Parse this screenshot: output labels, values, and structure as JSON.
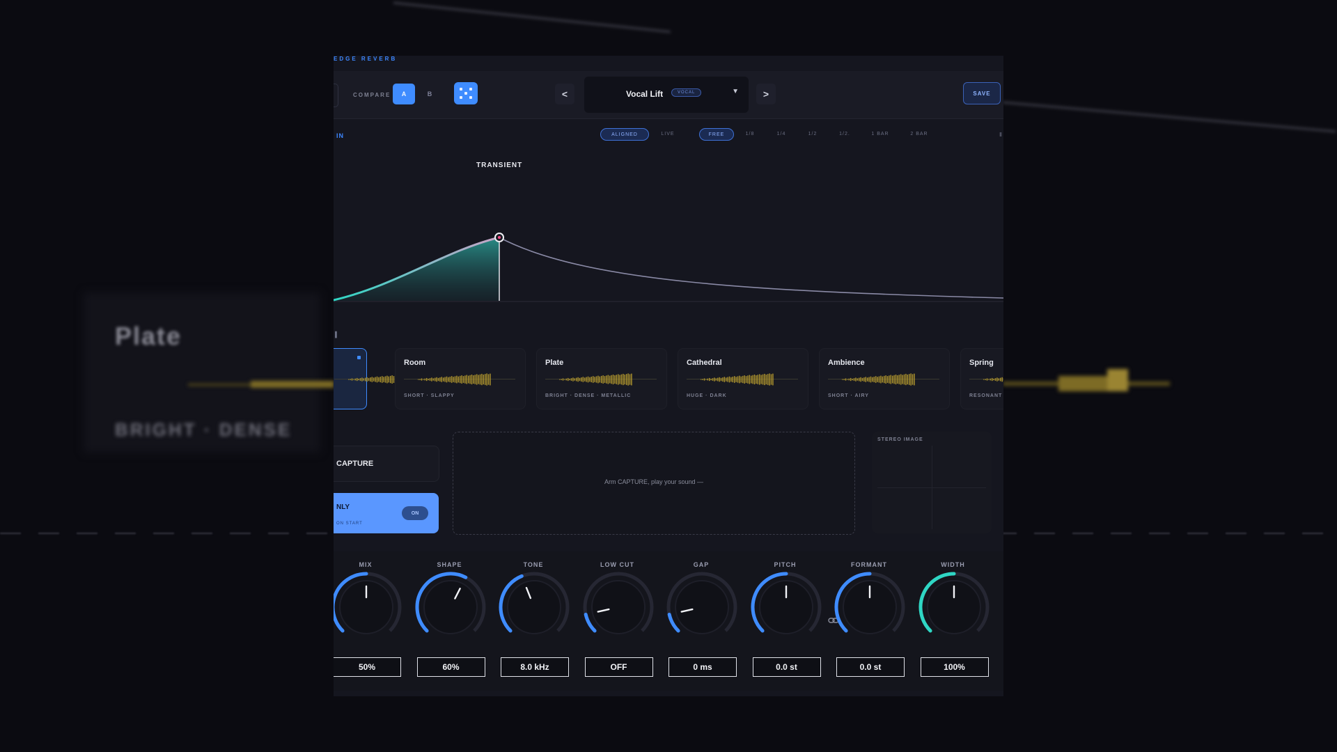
{
  "background": {
    "blurred_title": "Plate",
    "blurred_subtitle": "BRIGHT · DENSE"
  },
  "plugin": {
    "brand_strip": "EDGE REVERB",
    "compare": {
      "label": "COMPARE",
      "a": "A",
      "b": "B"
    },
    "preset": {
      "prev": "<",
      "next": ">",
      "name": "Vocal Lift",
      "tag": "VOCAL",
      "dropdown": "▼"
    },
    "save_label": "SAVE",
    "input_label": "IN",
    "sync_modes": [
      "ALIGNED",
      "LIVE"
    ],
    "time_divisions": [
      "FREE",
      "1/8",
      "1/4",
      "1/2",
      "1/2.",
      "1 BAR",
      "2 BAR"
    ],
    "selected_sync_mode": "ALIGNED",
    "selected_division": "FREE",
    "envelope": {
      "transient_label": "TRANSIENT"
    },
    "reverb_types": [
      {
        "name": "",
        "desc": "",
        "selected": true
      },
      {
        "name": "Room",
        "desc": "SHORT · SLAPPY"
      },
      {
        "name": "Plate",
        "desc": "BRIGHT · DENSE · METALLIC"
      },
      {
        "name": "Cathedral",
        "desc": "HUGE · DARK"
      },
      {
        "name": "Ambience",
        "desc": "SHORT · AIRY"
      },
      {
        "name": "Spring",
        "desc": "RESONANT ·"
      }
    ],
    "capture": {
      "label": "CAPTURE"
    },
    "only": {
      "label": "NLY",
      "sub": "ON START",
      "toggle": "ON"
    },
    "dropzone_text": "Arm CAPTURE, play your sound —",
    "stereo_label": "STEREO IMAGE",
    "knobs": [
      {
        "label": "MIX",
        "value": "50%",
        "level": 0.5,
        "accent": "#3f8cff"
      },
      {
        "label": "SHAPE",
        "value": "60%",
        "level": 0.6,
        "accent": "#3f8cff"
      },
      {
        "label": "TONE",
        "value": "8.0 kHz",
        "level": 0.42,
        "accent": "#3f8cff"
      },
      {
        "label": "LOW CUT",
        "value": "OFF",
        "level": 0.12,
        "accent": "#3f8cff"
      },
      {
        "label": "GAP",
        "value": "0 ms",
        "level": 0.12,
        "accent": "#3f8cff"
      },
      {
        "label": "PITCH",
        "value": "0.0 st",
        "level": 0.5,
        "accent": "#3f8cff"
      },
      {
        "label": "FORMANT",
        "value": "0.0 st",
        "level": 0.5,
        "accent": "#3f8cff"
      },
      {
        "label": "WIDTH",
        "value": "100%",
        "level": 0.5,
        "accent": "#2fd6c4"
      }
    ]
  },
  "colors": {
    "accent": "#3f8cff",
    "teal": "#2fd6c4",
    "waveform": "#b59a2e",
    "panel": "#15161f"
  }
}
